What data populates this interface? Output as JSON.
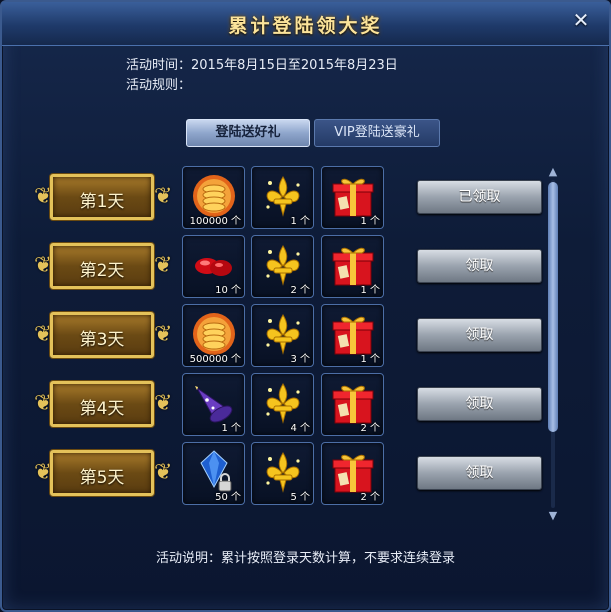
{
  "window": {
    "title": "累计登陆领大奖",
    "close_glyph": "✕"
  },
  "info": {
    "time": "活动时间：2015年8月15日至2015年8月23日",
    "rules": "活动规则："
  },
  "tabs": [
    {
      "label": "登陆送好礼",
      "active": true
    },
    {
      "label": "VIP登陆送豪礼",
      "active": false
    }
  ],
  "rows": [
    {
      "day": "第1天",
      "items": [
        {
          "icon": "gold-coins-icon",
          "count": "100000 个"
        },
        {
          "icon": "gold-fleur-icon",
          "count": "1 个"
        },
        {
          "icon": "red-gift-box-icon",
          "count": "1 个"
        }
      ],
      "button": "已领取"
    },
    {
      "day": "第2天",
      "items": [
        {
          "icon": "red-gems-icon",
          "count": "10 个"
        },
        {
          "icon": "gold-fleur-icon",
          "count": "2 个"
        },
        {
          "icon": "red-gift-box-icon",
          "count": "1 个"
        }
      ],
      "button": "领取"
    },
    {
      "day": "第3天",
      "items": [
        {
          "icon": "gold-coins-icon",
          "count": "500000 个"
        },
        {
          "icon": "gold-fleur-icon",
          "count": "3 个"
        },
        {
          "icon": "red-gift-box-icon",
          "count": "1 个"
        }
      ],
      "button": "领取"
    },
    {
      "day": "第4天",
      "items": [
        {
          "icon": "wizard-hat-icon",
          "count": "1 个"
        },
        {
          "icon": "gold-fleur-icon",
          "count": "4 个"
        },
        {
          "icon": "red-gift-box-icon",
          "count": "2 个"
        }
      ],
      "button": "领取"
    },
    {
      "day": "第5天",
      "items": [
        {
          "icon": "locked-blue-gem-icon",
          "count": "50 个"
        },
        {
          "icon": "gold-fleur-icon",
          "count": "5 个"
        },
        {
          "icon": "red-gift-box-icon",
          "count": "2 个"
        }
      ],
      "button": "领取"
    }
  ],
  "footer": {
    "note": "活动说明：累计按照登录天数计算，不要求连续登录"
  },
  "colors": {
    "title_gold": "#fbe39a",
    "panel_blue": "#16284c",
    "plaque_gold": "#e4c25a",
    "button_gray": "#9aa3ae"
  }
}
